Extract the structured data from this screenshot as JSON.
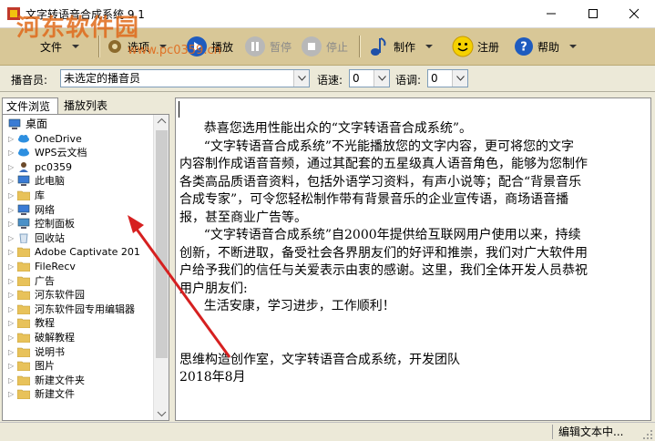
{
  "window": {
    "title": "文字转语音合成系统 9.1",
    "watermark": "河东软件园",
    "watermark_url": "www.pc0359.cn"
  },
  "toolbar": {
    "file_label": "文件",
    "options_label": "选项",
    "play_label": "播放",
    "pause_label": "暂停",
    "stop_label": "停止",
    "make_label": "制作",
    "register_label": "注册",
    "help_label": "帮助"
  },
  "controls": {
    "speaker_label": "播音员:",
    "speaker_value": "未选定的播音员",
    "speed_label": "语速:",
    "speed_value": "0",
    "pitch_label": "语调:",
    "pitch_value": "0"
  },
  "tabs": [
    "文件浏览",
    "播放列表"
  ],
  "tree": [
    {
      "label": "桌面",
      "icon": "desktop-icon",
      "level": 0
    },
    {
      "label": "OneDrive",
      "icon": "cloud-icon",
      "level": 1
    },
    {
      "label": "WPS云文档",
      "icon": "cloud-icon",
      "level": 1
    },
    {
      "label": "pc0359",
      "icon": "user-icon",
      "level": 1
    },
    {
      "label": "此电脑",
      "icon": "computer-icon",
      "level": 1
    },
    {
      "label": "库",
      "icon": "folder-icon",
      "level": 1
    },
    {
      "label": "网络",
      "icon": "network-icon",
      "level": 1
    },
    {
      "label": "控制面板",
      "icon": "control-panel-icon",
      "level": 1
    },
    {
      "label": "回收站",
      "icon": "recycle-bin-icon",
      "level": 1
    },
    {
      "label": "Adobe Captivate 201",
      "icon": "folder-icon",
      "level": 1
    },
    {
      "label": "FileRecv",
      "icon": "folder-icon",
      "level": 1
    },
    {
      "label": "广告",
      "icon": "folder-icon",
      "level": 1
    },
    {
      "label": "河东软件园",
      "icon": "folder-icon",
      "level": 1
    },
    {
      "label": "河东软件园专用编辑器",
      "icon": "folder-icon",
      "level": 1
    },
    {
      "label": "教程",
      "icon": "folder-icon",
      "level": 1
    },
    {
      "label": "破解教程",
      "icon": "folder-icon",
      "level": 1
    },
    {
      "label": "说明书",
      "icon": "folder-icon",
      "level": 1
    },
    {
      "label": "图片",
      "icon": "folder-icon",
      "level": 1
    },
    {
      "label": "新建文件夹",
      "icon": "folder-icon",
      "level": 1
    },
    {
      "label": "新建文件",
      "icon": "folder-icon",
      "level": 1
    }
  ],
  "editor": {
    "lines": [
      "      恭喜您选用性能出众的“文字转语音合成系统”。",
      "      “文字转语音合成系统”不光能播放您的文字内容，更可将您的文字",
      "内容制作成语音音频，通过其配套的五星级真人语音角色，能够为您制作",
      "各类高品质语音资料，包括外语学习资料，有声小说等；配合“背景音乐",
      "合成专家”，可令您轻松制作带有背景音乐的企业宣传语，商场语音播",
      "报，甚至商业广告等。",
      "      “文字转语音合成系统”自2000年提供给互联网用户使用以来，持续",
      "创新，不断进取，备受社会各界朋友们的好评和推崇，我们对广大软件用",
      "户给予我们的信任与关爱表示由衷的感谢。这里，我们全体开发人员恭祝",
      "用户朋友们:",
      "      生活安康，学习进步，工作顺利！",
      "",
      "",
      "思维构造创作室，文字转语音合成系统，开发团队",
      "2018年8月"
    ]
  },
  "status": {
    "text": "编辑文本中..."
  },
  "colors": {
    "toolbar_bg": "#d8c797",
    "annotation_arrow": "#d62020"
  }
}
